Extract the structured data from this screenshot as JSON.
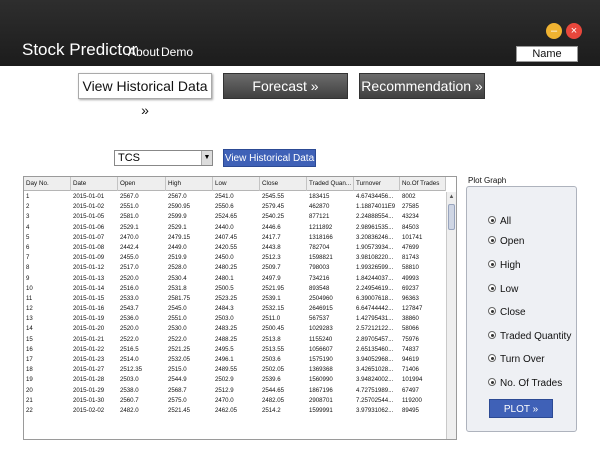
{
  "header": {
    "title": "Stock Predictor",
    "menu": [
      "About",
      "Demo"
    ],
    "user_name": "Name",
    "minimize_glyph": "–",
    "close_glyph": "×"
  },
  "nav": {
    "historical": "View Historical Data »",
    "forecast": "Forecast »",
    "recommendation": "Recommendation »"
  },
  "controls": {
    "stock_selected": "TCS",
    "view_button": "View Historical Data"
  },
  "table": {
    "columns": [
      "Day No.",
      "Date",
      "Open",
      "High",
      "Low",
      "Close",
      "Traded Quan...",
      "Turnover",
      "No.Of Trades"
    ],
    "rows": [
      [
        "1",
        "2015-01-01",
        "2567.0",
        "2567.0",
        "2541.0",
        "2545.55",
        "183415",
        "4.67434456...",
        "8002"
      ],
      [
        "2",
        "2015-01-02",
        "2551.0",
        "2590.95",
        "2550.6",
        "2579.45",
        "462870",
        "1.18874011E9",
        "27585"
      ],
      [
        "3",
        "2015-01-05",
        "2581.0",
        "2599.9",
        "2524.65",
        "2540.25",
        "877121",
        "2.24888554...",
        "43234"
      ],
      [
        "4",
        "2015-01-06",
        "2529.1",
        "2529.1",
        "2440.0",
        "2446.6",
        "1211892",
        "2.98961535...",
        "84503"
      ],
      [
        "5",
        "2015-01-07",
        "2470.0",
        "2479.15",
        "2407.45",
        "2417.7",
        "1318166",
        "3.20836246...",
        "101741"
      ],
      [
        "6",
        "2015-01-08",
        "2442.4",
        "2449.0",
        "2420.55",
        "2443.8",
        "782704",
        "1.90573934...",
        "47699"
      ],
      [
        "7",
        "2015-01-09",
        "2455.0",
        "2519.9",
        "2450.0",
        "2512.3",
        "1598821",
        "3.98108220...",
        "81743"
      ],
      [
        "8",
        "2015-01-12",
        "2517.0",
        "2528.0",
        "2480.25",
        "2509.7",
        "798003",
        "1.99326599...",
        "58810"
      ],
      [
        "9",
        "2015-01-13",
        "2520.0",
        "2530.4",
        "2480.1",
        "2497.9",
        "734216",
        "1.84244037...",
        "49993"
      ],
      [
        "10",
        "2015-01-14",
        "2516.0",
        "2531.8",
        "2500.5",
        "2521.95",
        "893548",
        "2.24954619...",
        "69237"
      ],
      [
        "11",
        "2015-01-15",
        "2533.0",
        "2581.75",
        "2523.25",
        "2539.1",
        "2504960",
        "6.39007618...",
        "96363"
      ],
      [
        "12",
        "2015-01-16",
        "2543.7",
        "2545.0",
        "2484.3",
        "2532.15",
        "2646915",
        "6.64744442...",
        "127847"
      ],
      [
        "13",
        "2015-01-19",
        "2536.0",
        "2551.0",
        "2503.0",
        "2511.0",
        "567537",
        "1.42795431...",
        "38860"
      ],
      [
        "14",
        "2015-01-20",
        "2520.0",
        "2530.0",
        "2483.25",
        "2500.45",
        "1029283",
        "2.57212122...",
        "58066"
      ],
      [
        "15",
        "2015-01-21",
        "2522.0",
        "2522.0",
        "2488.25",
        "2513.8",
        "1155240",
        "2.89705457...",
        "75976"
      ],
      [
        "16",
        "2015-01-22",
        "2516.5",
        "2521.25",
        "2495.5",
        "2513.55",
        "1056607",
        "2.65135460...",
        "74837"
      ],
      [
        "17",
        "2015-01-23",
        "2514.0",
        "2532.05",
        "2496.1",
        "2503.6",
        "1575190",
        "3.94052968...",
        "94619"
      ],
      [
        "18",
        "2015-01-27",
        "2512.35",
        "2515.0",
        "2489.55",
        "2502.05",
        "1369368",
        "3.42651028...",
        "71406"
      ],
      [
        "19",
        "2015-01-28",
        "2503.0",
        "2544.9",
        "2502.9",
        "2539.6",
        "1560990",
        "3.94824002...",
        "101994"
      ],
      [
        "20",
        "2015-01-29",
        "2538.0",
        "2568.7",
        "2512.9",
        "2544.65",
        "1867196",
        "4.72751989...",
        "67497"
      ],
      [
        "21",
        "2015-01-30",
        "2560.7",
        "2575.0",
        "2470.0",
        "2482.05",
        "2908701",
        "7.25702544...",
        "119200"
      ],
      [
        "22",
        "2015-02-02",
        "2482.0",
        "2521.45",
        "2462.05",
        "2514.2",
        "1599991",
        "3.97931062...",
        "89495"
      ]
    ]
  },
  "plot": {
    "label": "Plot Graph",
    "options": [
      "All",
      "Open",
      "High",
      "Low",
      "Close",
      "Traded Quantity",
      "Turn Over",
      "No. Of Trades"
    ],
    "button": "PLOT »"
  },
  "colors": {
    "header_bg": "#222222",
    "accent_blue": "#3f61b7",
    "nav_dark": "#505050",
    "minimize": "#f0b331",
    "close": "#e8473c"
  },
  "icons": {
    "select_arrow": "dropdown-arrow-icon",
    "scroll_up": "scroll-up-arrow-icon"
  }
}
